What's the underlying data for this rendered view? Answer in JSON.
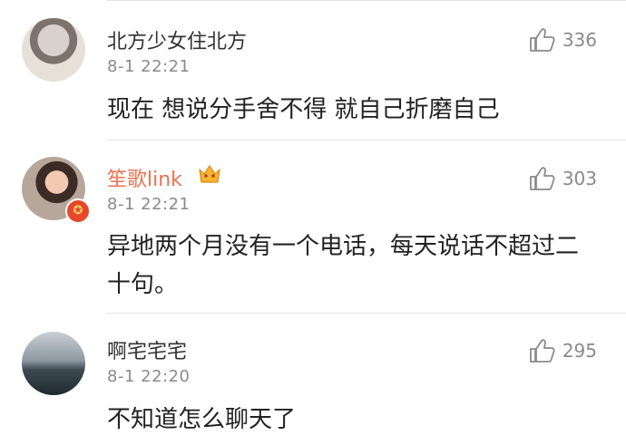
{
  "comments": [
    {
      "username": "北方少女住北方",
      "time": "8-1 22:21",
      "likes": "336",
      "text": "现在  想说分手舍不得 就自己折磨自己"
    },
    {
      "username": "笙歌link",
      "time": "8-1 22:21",
      "likes": "303",
      "text": "异地两个月没有一个电话，每天说话不超过二十句。",
      "name_color": "#eb7350",
      "badge_color": "#e8472b",
      "badge_icon": "verified-badge-icon",
      "vip_icon": "crown-vip-icon"
    },
    {
      "username": "啊宅宅宅",
      "time": "8-1 22:20",
      "likes": "295",
      "text": "不知道怎么聊天了"
    }
  ]
}
